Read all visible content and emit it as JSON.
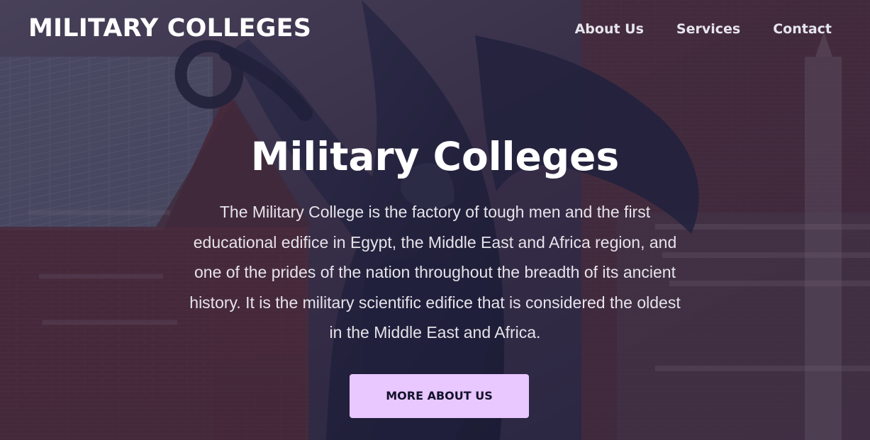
{
  "header": {
    "brand": "MILITARY COLLEGES",
    "nav": [
      {
        "label": "About Us"
      },
      {
        "label": "Services"
      },
      {
        "label": "Contact"
      }
    ]
  },
  "hero": {
    "title": "Military Colleges",
    "description": "The Military College is the factory of tough men and the first educational edifice in Egypt, the Middle East and Africa region, and one of the prides of the nation throughout the breadth of its ancient history. It is the military scientific edifice that is considered the oldest in the Middle East and Africa.",
    "button_label": "MORE ABOUT US"
  },
  "colors": {
    "overlay": "#221e3e",
    "button_background": "#e9c7ff",
    "button_text": "#12122b",
    "text": "#ffffff"
  }
}
